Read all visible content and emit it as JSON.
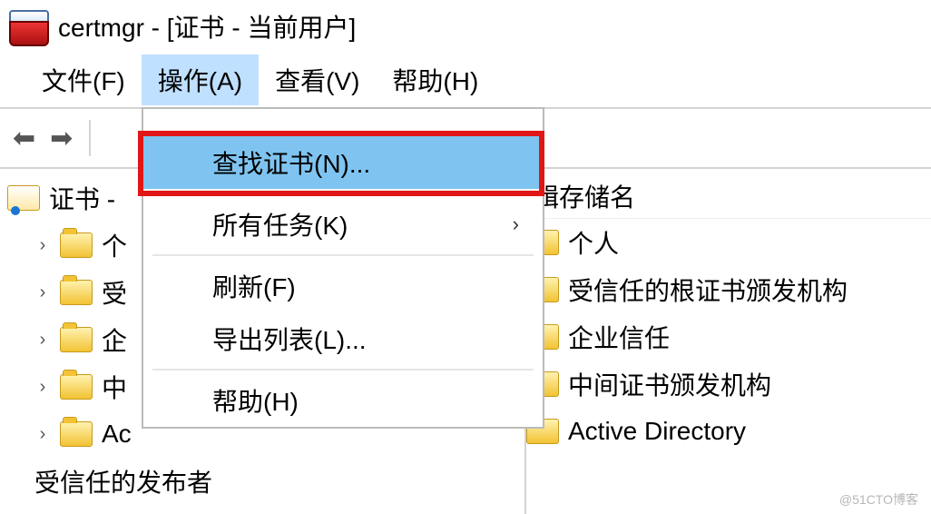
{
  "title": "certmgr - [证书 - 当前用户]",
  "menubar": {
    "file": "文件(F)",
    "action": "操作(A)",
    "view": "查看(V)",
    "help": "帮助(H)"
  },
  "dropdown": {
    "find_cert": "查找证书(N)...",
    "all_tasks": "所有任务(K)",
    "refresh": "刷新(F)",
    "export_list": "导出列表(L)...",
    "help": "帮助(H)"
  },
  "tree": {
    "root": "证书 -",
    "items": [
      "个",
      "受",
      "企",
      "中",
      "Ac",
      "受信任的发布者"
    ]
  },
  "list": {
    "column_header": "辑存储名",
    "items": [
      "个人",
      "受信任的根证书颁发机构",
      "企业信任",
      "中间证书颁发机构",
      "Active Directory"
    ]
  },
  "watermark": "@51CTO博客"
}
